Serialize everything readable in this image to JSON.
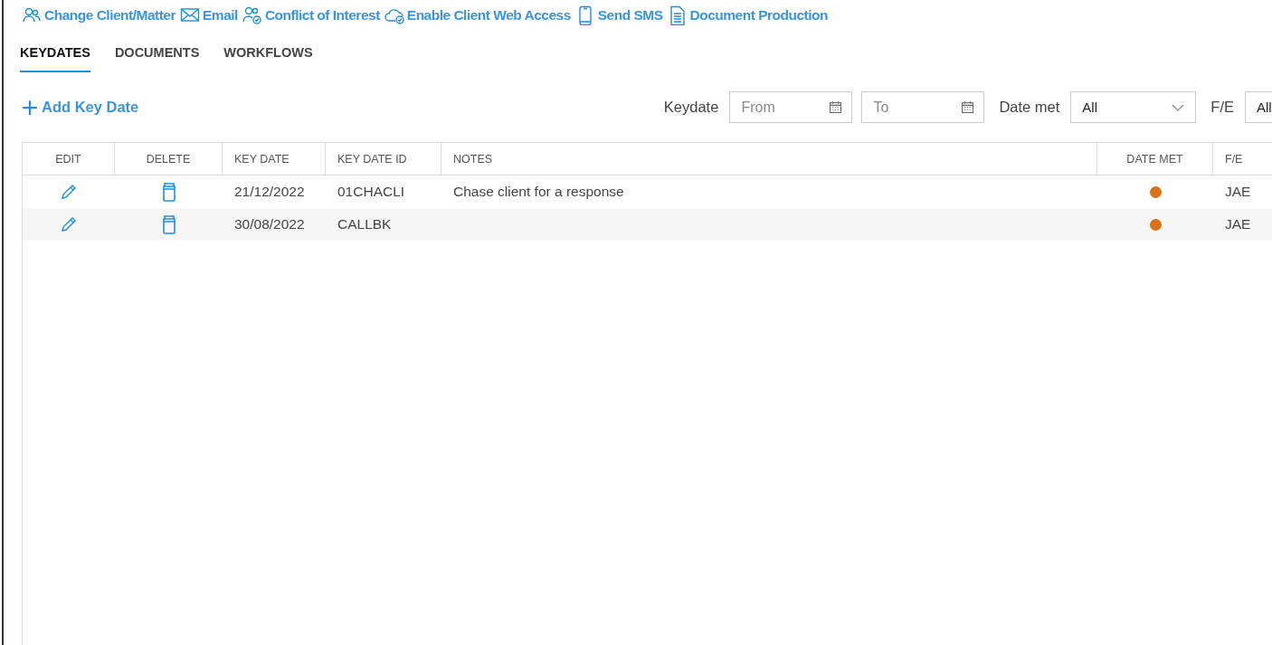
{
  "actions": [
    {
      "label": "Change Client/Matter",
      "kind": "people"
    },
    {
      "label": "Email",
      "kind": "envelope"
    },
    {
      "label": "Conflict of Interest",
      "kind": "personcheck"
    },
    {
      "label": "Enable Client Web Access",
      "kind": "cloudcheck"
    },
    {
      "label": "Send SMS",
      "kind": "phone"
    },
    {
      "label": "Document Production",
      "kind": "document"
    }
  ],
  "tabs": [
    {
      "label": "KEYDATES",
      "selected": true
    },
    {
      "label": "DOCUMENTS",
      "selected": false
    },
    {
      "label": "WORKFLOWS",
      "selected": false
    }
  ],
  "add_button": {
    "label": "Add Key Date"
  },
  "filters": {
    "keydate_label": "Keydate",
    "from": {
      "placeholder": "From"
    },
    "to": {
      "placeholder": "To"
    },
    "date_met_label": "Date met",
    "date_met": {
      "value": "All"
    },
    "fe_label": "F/E",
    "fe": {
      "value": "All"
    }
  },
  "table": {
    "columns": [
      "EDIT",
      "DELETE",
      "KEY DATE",
      "KEY DATE ID",
      "NOTES",
      "DATE MET",
      "F/E"
    ],
    "rows": [
      {
        "key_date": "21/12/2022",
        "key_date_id": "01CHACLI",
        "notes": "Chase client for a response",
        "color": "#d9731a",
        "fe": "JAE"
      },
      {
        "key_date": "30/08/2022",
        "key_date_id": "CALLBK",
        "notes": "",
        "color": "#d9731a",
        "fe": "JAE"
      }
    ]
  }
}
